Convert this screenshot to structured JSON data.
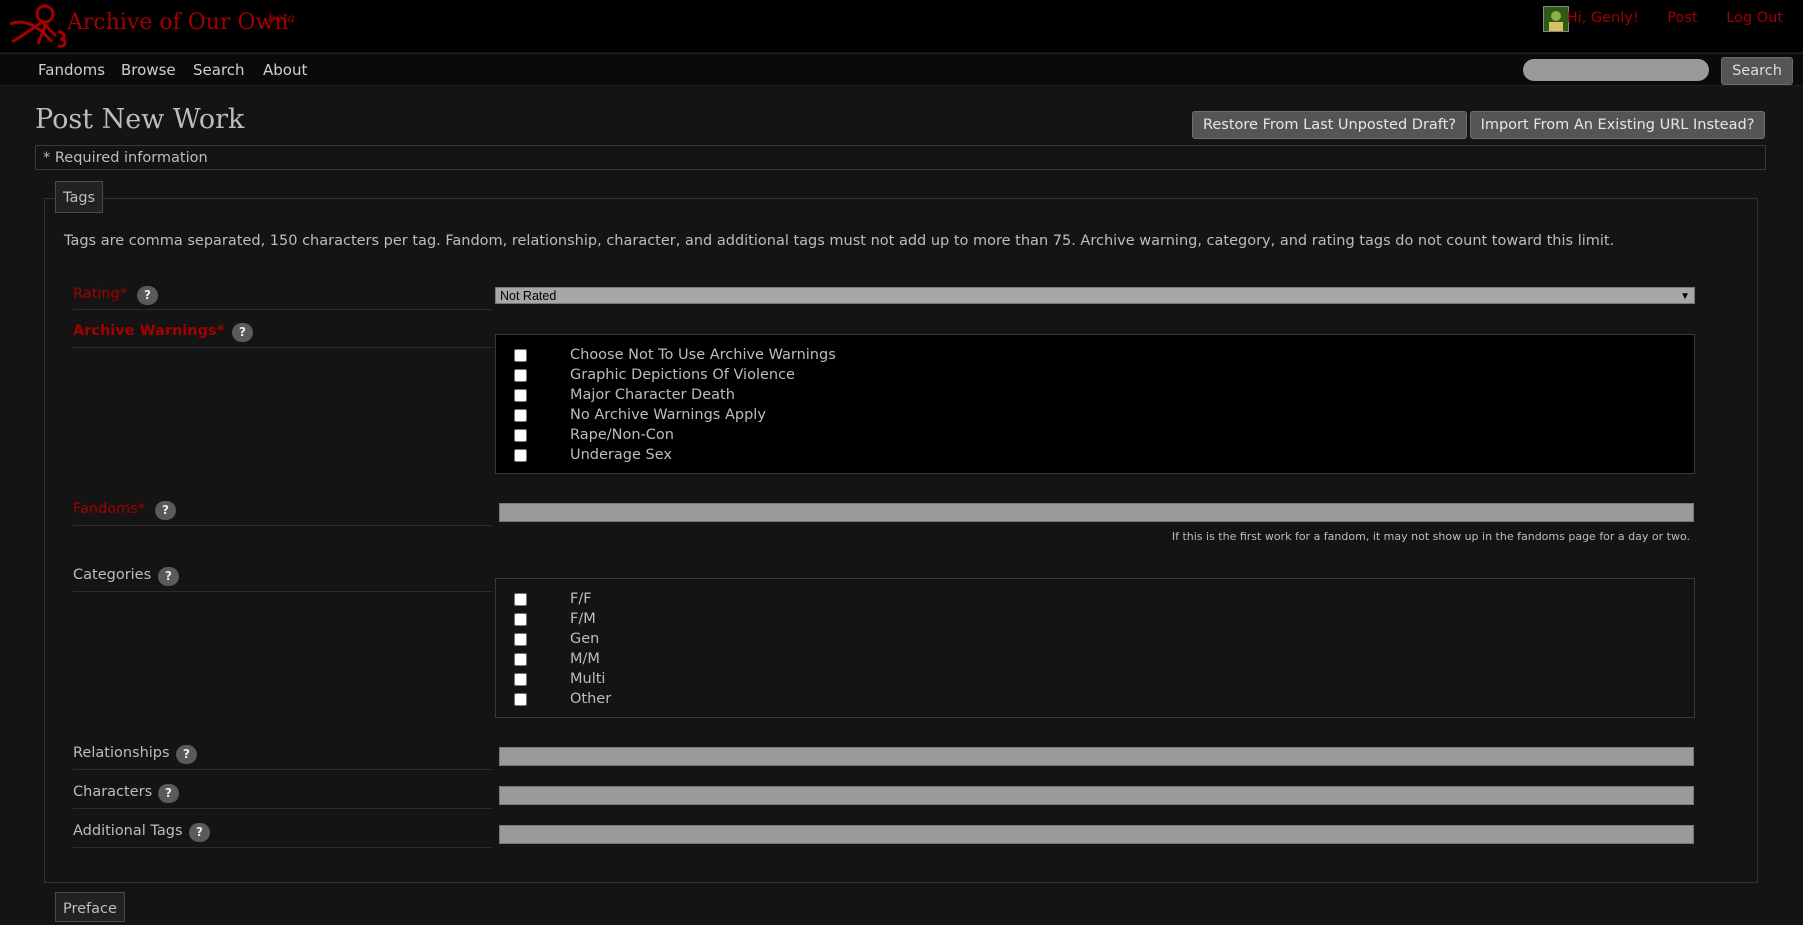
{
  "header": {
    "site_title": "Archive of Our Own",
    "site_beta": "beta",
    "user_nav": [
      "Hi, Genly!",
      "Post",
      "Log Out"
    ]
  },
  "nav": {
    "items": [
      "Fandoms",
      "Browse",
      "Search",
      "About"
    ],
    "search_button": "Search",
    "search_value": ""
  },
  "page": {
    "title": "Post New Work",
    "restore_button": "Restore From Last Unposted Draft?",
    "import_button": "Import From An Existing URL Instead?",
    "required_note": "* Required information"
  },
  "tags": {
    "legend": "Tags",
    "instructions": "Tags are comma separated, 150 characters per tag. Fandom, relationship, character, and additional tags must not add up to more than 75. Archive warning, category, and rating tags do not count toward this limit.",
    "help_glyph": "?",
    "rating": {
      "label": "Rating*",
      "selected": "Not Rated"
    },
    "warnings": {
      "label": "Archive Warnings*",
      "options": [
        "Choose Not To Use Archive Warnings",
        "Graphic Depictions Of Violence",
        "Major Character Death",
        "No Archive Warnings Apply",
        "Rape/Non-Con",
        "Underage Sex"
      ]
    },
    "fandoms": {
      "label": "Fandoms*",
      "value": "",
      "note": "If this is the first work for a fandom, it may not show up in the fandoms page for a day or two."
    },
    "categories": {
      "label": "Categories",
      "options": [
        "F/F",
        "F/M",
        "Gen",
        "M/M",
        "Multi",
        "Other"
      ]
    },
    "relationships": {
      "label": "Relationships",
      "value": ""
    },
    "characters": {
      "label": "Characters",
      "value": ""
    },
    "additional": {
      "label": "Additional Tags",
      "value": ""
    }
  },
  "preface": {
    "legend": "Preface"
  },
  "colors": {
    "brand": "#a30000",
    "background": "#141414",
    "header": "#000000",
    "field": "#9a9a9a"
  }
}
